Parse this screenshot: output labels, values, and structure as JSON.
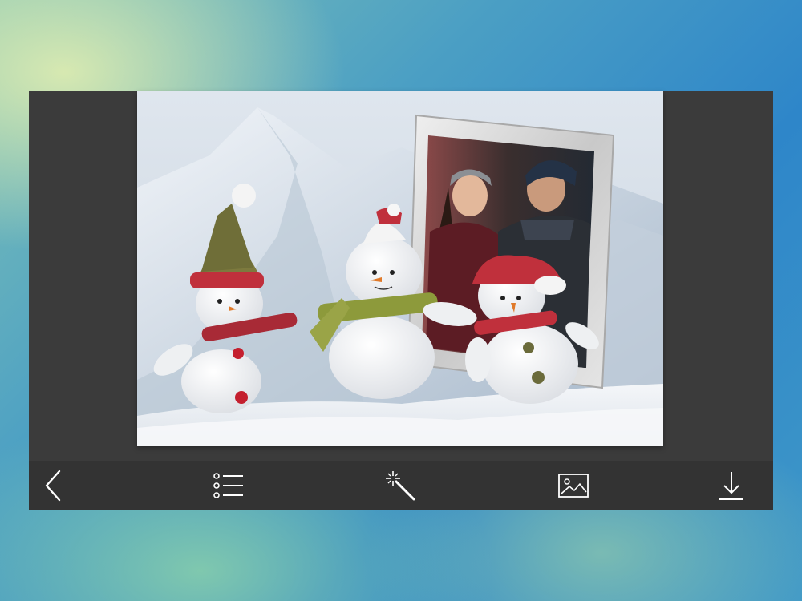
{
  "app": {
    "screen": "photo-frame-editor"
  },
  "canvas": {
    "scene": "snowmen-in-snow-with-photo-frame",
    "frame_style": "silver-photo-frame"
  },
  "toolbar": {
    "items": [
      {
        "icon": "chevron-left-icon",
        "action": "back"
      },
      {
        "icon": "list-icon",
        "action": "frames-list"
      },
      {
        "icon": "magic-wand-icon",
        "action": "effects"
      },
      {
        "icon": "image-icon",
        "action": "choose-photo"
      },
      {
        "icon": "download-icon",
        "action": "save"
      }
    ]
  },
  "colors": {
    "panel_bg": "#3b3b3b",
    "toolbar_bg": "#333333",
    "icon": "#ffffff"
  }
}
